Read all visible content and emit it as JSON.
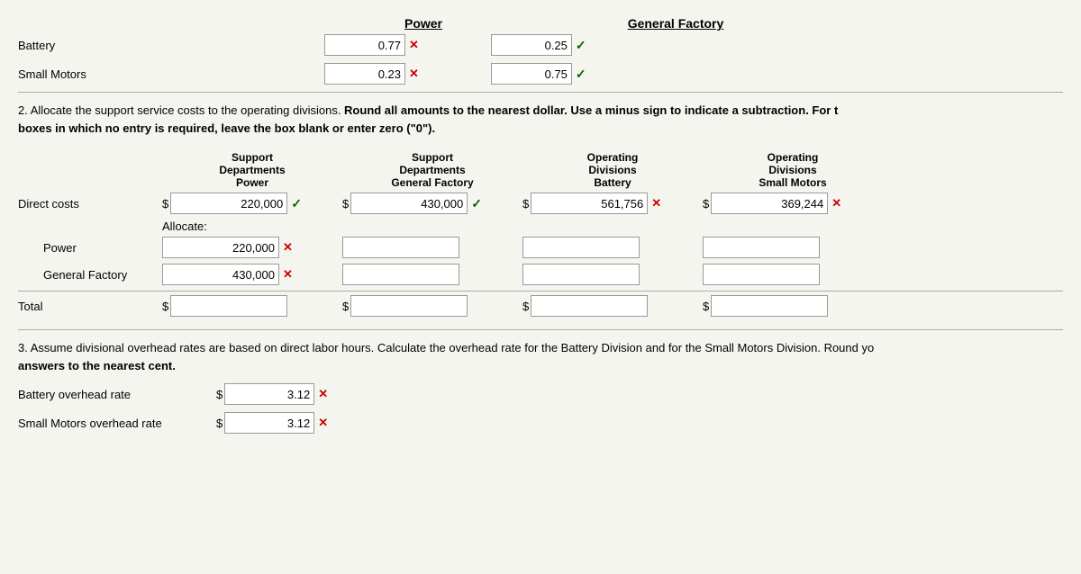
{
  "nav": {
    "back_arrow": "‹"
  },
  "top_section": {
    "power_header": "Power",
    "general_header": "General Factory",
    "rows": [
      {
        "label": "Battery",
        "power_value": "0.77",
        "power_status": "x",
        "general_value": "0.25",
        "general_status": "check"
      },
      {
        "label": "Small Motors",
        "power_value": "0.23",
        "power_status": "x",
        "general_value": "0.75",
        "general_status": "check"
      }
    ]
  },
  "instruction2": {
    "number": "2.",
    "text": " Allocate the support service costs to the operating divisions. ",
    "bold_part": "Round all amounts to the nearest dollar. Use a minus sign to indicate a subtraction. For t",
    "text2": "boxes in which no entry is required, leave the box blank or enter zero (\"0\")."
  },
  "table": {
    "headers": {
      "support_dept_label": "Support",
      "support_dept_sub": "Departments",
      "support_dept_power": "Power",
      "support_dept2_label": "Support",
      "support_dept2_sub": "Departments",
      "support_dept2_general": "General Factory",
      "op_div_label": "Operating",
      "op_div_sub": "Divisions",
      "op_div_battery": "Battery",
      "op_div2_label": "Operating",
      "op_div2_sub": "Divisions",
      "op_div2_small": "Small Motors"
    },
    "direct_costs": {
      "label": "Direct costs",
      "dollar": "$",
      "power_value": "220,000",
      "power_status": "check",
      "general_dollar": "$",
      "general_value": "430,000",
      "general_status": "check",
      "battery_dollar": "$",
      "battery_value": "561,756",
      "battery_status": "x",
      "small_dollar": "$",
      "small_value": "369,244",
      "small_status": "x"
    },
    "allocate_label": "Allocate:",
    "power_row": {
      "label": "Power",
      "power_value": "220,000",
      "power_status": "x",
      "general_value": "",
      "battery_value": "",
      "small_value": ""
    },
    "general_row": {
      "label": "General Factory",
      "power_value": "430,000",
      "power_status": "x",
      "general_value": "",
      "battery_value": "",
      "small_value": ""
    },
    "total_row": {
      "label": "Total",
      "dollar1": "$",
      "dollar2": "$",
      "dollar3": "$",
      "dollar4": "$"
    }
  },
  "section3": {
    "instruction": "3. Assume divisional overhead rates are based on direct labor hours. Calculate the overhead rate for the Battery Division and for the Small Motors Division. Round yo",
    "instruction2": "answers to the nearest cent.",
    "battery_label": "Battery overhead rate",
    "battery_dollar": "$",
    "battery_value": "3.12",
    "battery_status": "x",
    "small_label": "Small Motors overhead rate",
    "small_dollar": "$",
    "small_value": "3.12",
    "small_status": "x"
  }
}
